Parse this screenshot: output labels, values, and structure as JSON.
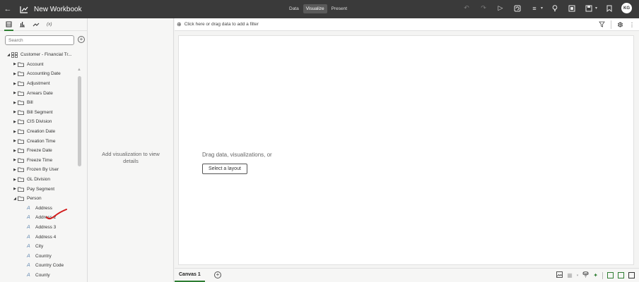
{
  "app": {
    "title": "New Workbook",
    "modes": [
      "Data",
      "Visualize",
      "Present"
    ],
    "active_mode": "Visualize",
    "avatar_initials": "KG",
    "accent_color": "#2e7d32"
  },
  "left_panel": {
    "tabs": [
      "data-tab",
      "visualizations-tab",
      "analytics-tab",
      "variables-tab"
    ],
    "variables_label": "(x)",
    "search_placeholder": "Search",
    "dataset": "Customer - Financial Tr...",
    "folders": [
      "Account",
      "Accounting Date",
      "Adjustment",
      "Arrears Date",
      "Bill",
      "Bill Segment",
      "CIS Division",
      "Creation Date",
      "Creation Time",
      "Freeze Date",
      "Freeze Time",
      "Frozen By User",
      "GL Division",
      "Pay Segment",
      "Person"
    ],
    "person_attributes": [
      "Address",
      "Address 2",
      "Address 3",
      "Address 4",
      "City",
      "Country",
      "Country Code",
      "County"
    ]
  },
  "middle_panel": {
    "hint": "Add visualization to view details"
  },
  "filter_bar": {
    "hint": "Click here or drag data to add a filter"
  },
  "canvas": {
    "hint": "Drag data, visualizations, or",
    "layout_button": "Select a layout"
  },
  "bottom_bar": {
    "canvas_tab": "Canvas 1"
  }
}
